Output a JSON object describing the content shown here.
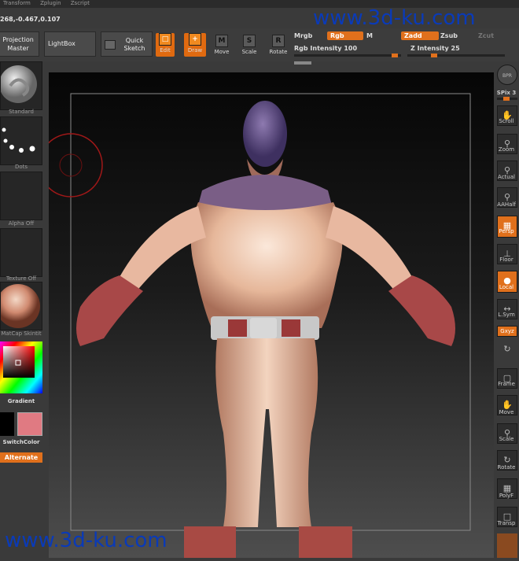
{
  "menu": [
    "Transform",
    "Zplugin",
    "Zscript"
  ],
  "coords": "268,-0.467,0.107",
  "toolbar": {
    "projection_line1": "Projection",
    "projection_line2": "Master",
    "lightbox": "LightBox",
    "quicksketch_line1": "Quick",
    "quicksketch_line2": "Sketch",
    "edit": "Edit",
    "draw": "Draw",
    "move": "Move",
    "scale": "Scale",
    "rotate": "Rotate",
    "move_glyph": "M",
    "scale_glyph": "S",
    "rotate_glyph": "R",
    "mrgb": "Mrgb",
    "rgb": "Rgb",
    "m": "M",
    "zadd": "Zadd",
    "zsub": "Zsub",
    "zcut": "Zcut",
    "rgb_intensity": "Rgb  Intensity 100",
    "rgb_intensity_value": 100,
    "z_intensity": "Z Intensity 25",
    "z_intensity_value": 25
  },
  "left": {
    "brush": "Standard",
    "stroke": "Dots",
    "alpha": "Alpha Off",
    "texture": "Texture Off",
    "material": "MatCap Skintit",
    "gradient": "Gradient",
    "switch_color": "SwitchColor",
    "alternate": "Alternate",
    "secondary_color": "#e07a82"
  },
  "right": {
    "bpr": "BPR",
    "spix": "SPix 3",
    "scroll": "Scroll",
    "zoom": "Zoom",
    "actual": "Actual",
    "aahalf": "AAHalf",
    "persp": "Persp",
    "floor": "Floor",
    "local": "Local",
    "lsym": "L.Sym",
    "xyz": "Gxyz",
    "frame": "Frame",
    "move": "Move",
    "scale": "Scale",
    "rotate": "Rotate",
    "polyf": "PolyF",
    "transp": "Transp"
  },
  "watermark": "www.3d-ku.com",
  "colors": {
    "accent": "#e0701c",
    "skin": "#e8c2a8",
    "suit_red": "#b04a48",
    "head": "#6a5a8a"
  }
}
